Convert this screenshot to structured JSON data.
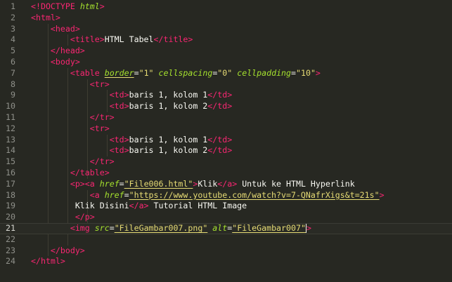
{
  "editor": {
    "lines": [
      {
        "n": "1",
        "tokens": [
          [
            "tag",
            "<!DOCTYPE "
          ],
          [
            "attr",
            "html"
          ],
          [
            "tag",
            ">"
          ]
        ]
      },
      {
        "n": "2",
        "tokens": [
          [
            "tag",
            "<html>"
          ]
        ]
      },
      {
        "n": "3",
        "tokens": [
          [
            "txt",
            "    "
          ],
          [
            "tag",
            "<head>"
          ]
        ]
      },
      {
        "n": "4",
        "tokens": [
          [
            "txt",
            "        "
          ],
          [
            "tag",
            "<title>"
          ],
          [
            "txt",
            "HTML Tabel"
          ],
          [
            "tag",
            "</title>"
          ]
        ]
      },
      {
        "n": "5",
        "tokens": [
          [
            "txt",
            "    "
          ],
          [
            "tag",
            "</head>"
          ]
        ]
      },
      {
        "n": "6",
        "tokens": [
          [
            "txt",
            "    "
          ],
          [
            "tag",
            "<body>"
          ]
        ]
      },
      {
        "n": "7",
        "tokens": [
          [
            "txt",
            "        "
          ],
          [
            "tag",
            "<table "
          ],
          [
            "attr",
            "border"
          ],
          [
            "txt",
            "="
          ],
          [
            "str",
            "\"1\""
          ],
          [
            "txt",
            " "
          ],
          [
            "attr",
            "cellspacing"
          ],
          [
            "txt",
            "="
          ],
          [
            "str",
            "\"0\""
          ],
          [
            "txt",
            " "
          ],
          [
            "attr",
            "cellpadding"
          ],
          [
            "txt",
            "="
          ],
          [
            "str",
            "\"10\""
          ],
          [
            "tag",
            ">"
          ]
        ]
      },
      {
        "n": "8",
        "tokens": [
          [
            "txt",
            "            "
          ],
          [
            "tag",
            "<tr>"
          ]
        ]
      },
      {
        "n": "9",
        "tokens": [
          [
            "txt",
            "                "
          ],
          [
            "tag",
            "<td>"
          ],
          [
            "txt",
            "baris 1, kolom 1"
          ],
          [
            "tag",
            "</td>"
          ]
        ]
      },
      {
        "n": "10",
        "tokens": [
          [
            "txt",
            "                "
          ],
          [
            "tag",
            "<td>"
          ],
          [
            "txt",
            "baris 1, kolom 2"
          ],
          [
            "tag",
            "</td>"
          ]
        ]
      },
      {
        "n": "11",
        "tokens": [
          [
            "txt",
            "            "
          ],
          [
            "tag",
            "</tr>"
          ]
        ]
      },
      {
        "n": "12",
        "tokens": [
          [
            "txt",
            "            "
          ],
          [
            "tag",
            "<tr>"
          ]
        ]
      },
      {
        "n": "13",
        "tokens": [
          [
            "txt",
            "                "
          ],
          [
            "tag",
            "<td>"
          ],
          [
            "txt",
            "baris 1, kolom 1"
          ],
          [
            "tag",
            "</td>"
          ]
        ]
      },
      {
        "n": "14",
        "tokens": [
          [
            "txt",
            "                "
          ],
          [
            "tag",
            "<td>"
          ],
          [
            "txt",
            "baris 1, kolom 2"
          ],
          [
            "tag",
            "</td>"
          ]
        ]
      },
      {
        "n": "15",
        "tokens": [
          [
            "txt",
            "            "
          ],
          [
            "tag",
            "</tr>"
          ]
        ]
      },
      {
        "n": "16",
        "tokens": [
          [
            "txt",
            "        "
          ],
          [
            "tag",
            "</table>"
          ]
        ]
      },
      {
        "n": "17",
        "tokens": [
          [
            "txt",
            "        "
          ],
          [
            "tag",
            "<p>"
          ],
          [
            "tag",
            "<a "
          ],
          [
            "attr",
            "href"
          ],
          [
            "txt",
            "="
          ],
          [
            "str",
            "\"File006.html\""
          ],
          [
            "tag",
            ">"
          ],
          [
            "txt",
            "Klik"
          ],
          [
            "tag",
            "</a>"
          ],
          [
            "txt",
            " Untuk ke HTML Hyperlink"
          ]
        ]
      },
      {
        "n": "18",
        "tokens": [
          [
            "txt",
            "            "
          ],
          [
            "tag",
            "<a "
          ],
          [
            "attr",
            "href"
          ],
          [
            "txt",
            "="
          ],
          [
            "str",
            "\"https://www.youtube.com/watch?v=7-QNafrXigs&t=21s\""
          ],
          [
            "tag",
            ">"
          ]
        ]
      },
      {
        "n": "19",
        "tokens": [
          [
            "txt",
            "         Klik Disini"
          ],
          [
            "tag",
            "</a>"
          ],
          [
            "txt",
            " Tutorial HTML Image"
          ]
        ]
      },
      {
        "n": "20",
        "tokens": [
          [
            "txt",
            "         "
          ],
          [
            "tag",
            "</p>"
          ]
        ]
      },
      {
        "n": "21",
        "active": true,
        "tokens": [
          [
            "txt",
            "        "
          ],
          [
            "tag",
            "<img "
          ],
          [
            "attr",
            "src"
          ],
          [
            "txt",
            "="
          ],
          [
            "str",
            "\"FileGambar007.png\""
          ],
          [
            "txt",
            " "
          ],
          [
            "attr",
            "alt"
          ],
          [
            "txt",
            "="
          ],
          [
            "str",
            "\"FileGambar007\""
          ],
          [
            "cursor",
            ""
          ],
          [
            "tag",
            ">"
          ]
        ]
      },
      {
        "n": "22",
        "tokens": []
      },
      {
        "n": "23",
        "tokens": [
          [
            "txt",
            "    "
          ],
          [
            "tag",
            "</body>"
          ]
        ]
      },
      {
        "n": "24",
        "tokens": [
          [
            "tag",
            "</html>"
          ]
        ]
      }
    ]
  },
  "colors": {
    "background": "#272822",
    "tag": "#f92672",
    "attribute": "#a6e22e",
    "string": "#e6db74",
    "text": "#f8f8f2",
    "gutter": "#8f908a"
  }
}
